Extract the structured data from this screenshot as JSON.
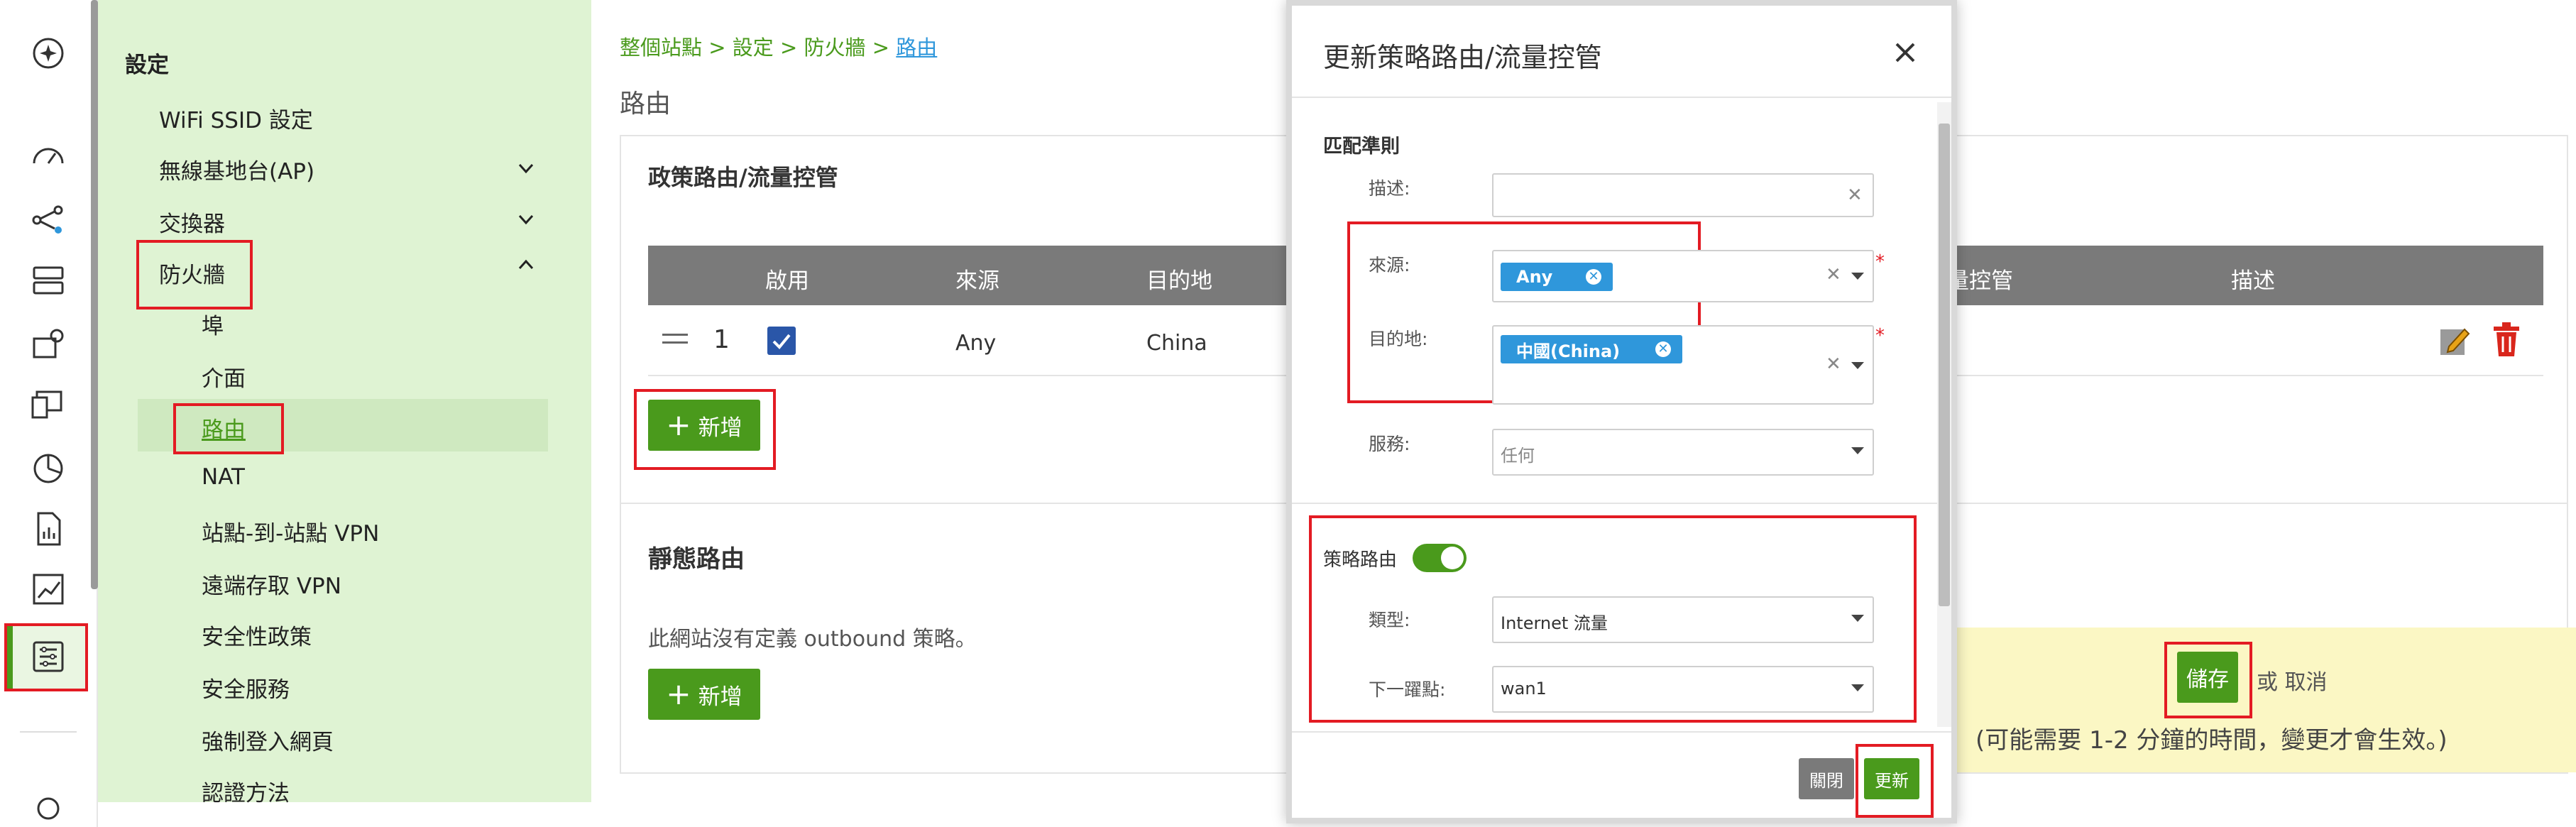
{
  "settings_panel": {
    "title": "設定",
    "items": [
      {
        "label": "WiFi SSID 設定"
      },
      {
        "label": "無線基地台(AP)"
      },
      {
        "label": "交換器"
      },
      {
        "label": "防火牆"
      }
    ],
    "firewall_subitems": [
      {
        "label": "埠"
      },
      {
        "label": "介面"
      },
      {
        "label": "路由"
      },
      {
        "label": "NAT"
      },
      {
        "label": "站點-到-站點 VPN"
      },
      {
        "label": "遠端存取 VPN"
      },
      {
        "label": "安全性政策"
      },
      {
        "label": "安全服務"
      },
      {
        "label": "強制登入網頁"
      },
      {
        "label": "認證方法"
      }
    ]
  },
  "breadcrumb": {
    "part1": "整個站點",
    "sep": ">",
    "part2": "設定",
    "part3": "防火牆",
    "current": "路由"
  },
  "page_title": "路由",
  "policy_section": {
    "title": "政策路由/流量控管",
    "columns": [
      "啟用",
      "來源",
      "目的地",
      "量控管",
      "描述"
    ],
    "rows": [
      {
        "order": "1",
        "source": "Any",
        "destination": "China",
        "enabled": true
      }
    ],
    "add_label": "新增"
  },
  "static_section": {
    "title": "靜態路由",
    "empty_text": "此網站沒有定義 outbound 策略。",
    "add_label": "新增"
  },
  "save_bar": {
    "save_label": "儲存",
    "or_text": "或",
    "cancel_label": "取消",
    "note": "(可能需要 1-2 分鐘的時間，變更才會生效。)"
  },
  "modal": {
    "title": "更新策略路由/流量控管",
    "match_section": "匹配準則",
    "description_label": "描述:",
    "description_value": "",
    "source_label": "來源:",
    "source_tag": "Any",
    "destination_label": "目的地:",
    "destination_tag": "中國(China)",
    "service_label": "服務:",
    "service_value": "任何",
    "policy_route_label": "策略路由",
    "policy_route_on": true,
    "type_label": "類型:",
    "type_value": "Internet 流量",
    "next_hop_label": "下一躍點:",
    "next_hop_value": "wan1",
    "close_label": "關閉",
    "update_label": "更新",
    "required_mark": "*"
  },
  "colors": {
    "accent_green": "#4a9a1c",
    "highlight_red": "#e31b23",
    "tag_blue": "#2f97db",
    "table_header": "#7a7a7a",
    "settings_bg": "#dff3d3",
    "save_bar_bg": "#fbf7c4"
  }
}
